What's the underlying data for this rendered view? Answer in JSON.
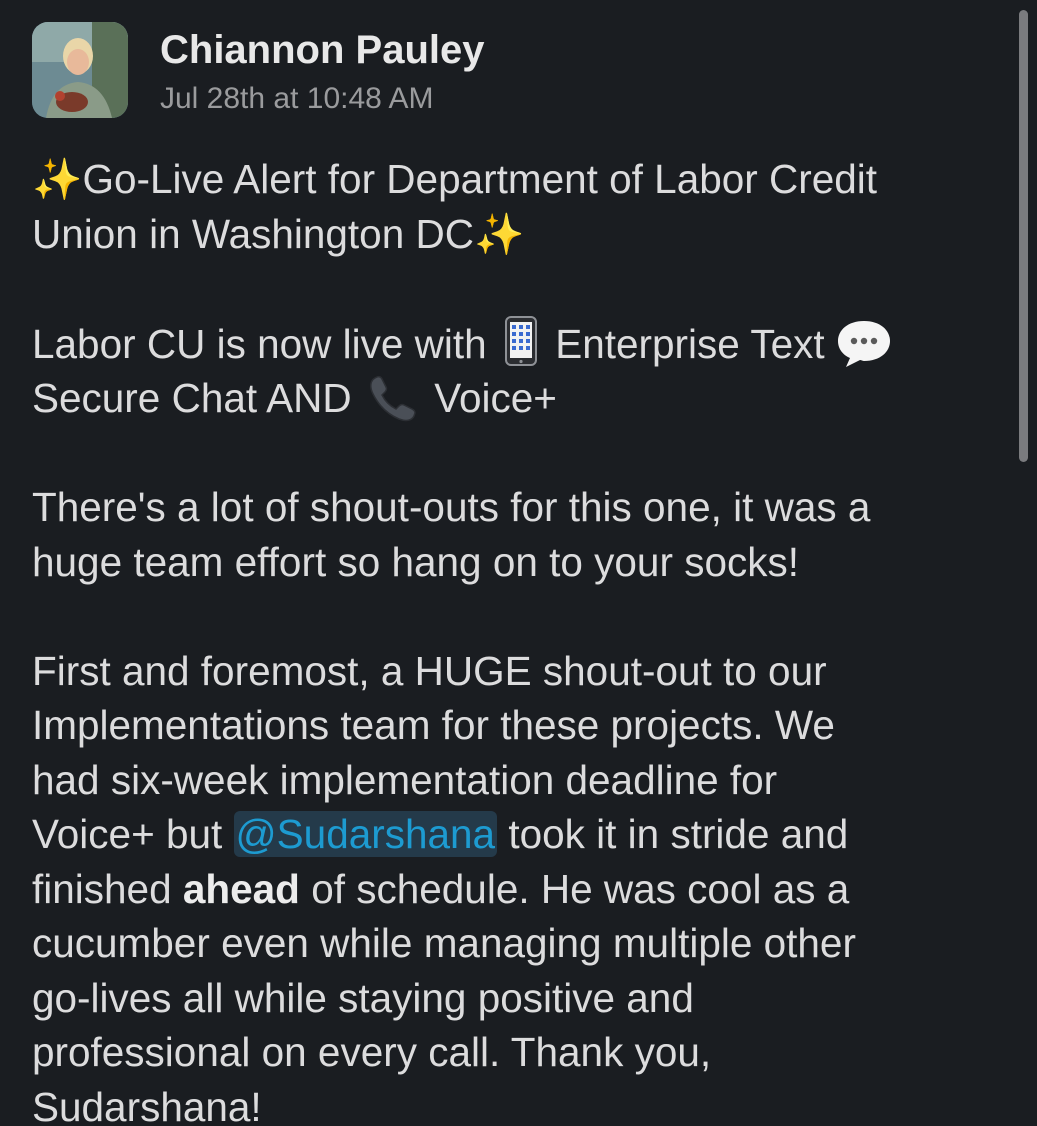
{
  "message": {
    "author": "Chiannon Pauley",
    "timestamp": "Jul 28th at 10:48 AM",
    "avatar_icon": "user-avatar-photo",
    "paragraphs": {
      "p1": {
        "line1": "Go-Live Alert for Department of Labor Credit",
        "line2": "Union in Washington DC"
      },
      "p2": {
        "line1_a": "Labor CU is now live with",
        "line1_b": "Enterprise Text",
        "line2_a": "Secure Chat AND",
        "line2_b": "Voice+"
      },
      "p3": {
        "line1": "There's a lot of shout-outs for this one, it was a",
        "line2": "huge team effort so hang on to your socks!"
      },
      "p4": {
        "line1": "First and foremost, a HUGE shout-out to our",
        "line2": "Implementations team for these projects. We",
        "line3": "had six-week implementation deadline for",
        "line4_a": "Voice+ but",
        "mention": "@Sudarshana",
        "line4_b": "took it in stride and",
        "line5_a": "finished",
        "line5_bold": "ahead",
        "line5_b": "of schedule. He was cool as a",
        "line6": "cucumber even while managing multiple other",
        "line7": "go-lives all while staying positive and",
        "line8": "professional on every call. Thank you,",
        "line9": "Sudarshana!"
      }
    },
    "icons": {
      "sparkles": "sparkles-icon",
      "phone": "mobile-phone-icon",
      "bubble": "speech-bubble-icon",
      "handset": "telephone-receiver-icon"
    },
    "emoji": {
      "sparkles": "✨"
    }
  },
  "colors": {
    "background": "#1a1d21",
    "text": "#dcdcdd",
    "muted": "#9a9b9d",
    "mention": "#1d9bd1",
    "mention_bg": "#243a4a"
  }
}
